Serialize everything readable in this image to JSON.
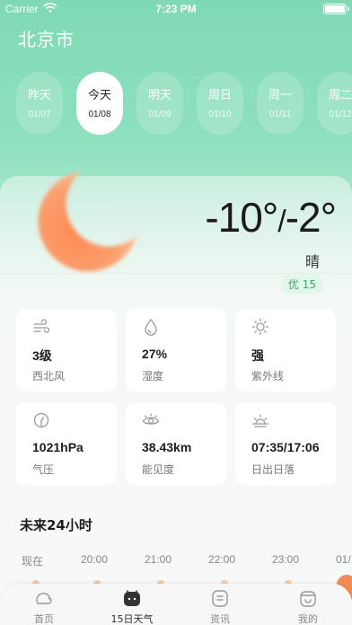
{
  "status_bar": {
    "carrier": "Carrier",
    "time": "7:23 PM"
  },
  "city": "北京市",
  "days": [
    {
      "name": "昨天",
      "date": "01/07",
      "active": false
    },
    {
      "name": "今天",
      "date": "01/08",
      "active": true
    },
    {
      "name": "明天",
      "date": "01/09",
      "active": false
    },
    {
      "name": "周日",
      "date": "01/10",
      "active": false
    },
    {
      "name": "周一",
      "date": "01/11",
      "active": false
    },
    {
      "name": "周二",
      "date": "01/12",
      "active": false
    }
  ],
  "weather": {
    "low": "-10°",
    "high": "-2°",
    "condition": "晴",
    "aqi": "优 15"
  },
  "details": [
    {
      "icon": "wind-icon",
      "value": "3级",
      "label": "西北风"
    },
    {
      "icon": "humidity-icon",
      "value": "27%",
      "label": "湿度"
    },
    {
      "icon": "sun-icon",
      "value": "强",
      "label": "紫外线"
    },
    {
      "icon": "pressure-icon",
      "value": "1021hPa",
      "label": "气压"
    },
    {
      "icon": "visibility-icon",
      "value": "38.43km",
      "label": "能见度"
    },
    {
      "icon": "sunrise-icon",
      "value": "07:35/17:06",
      "label": "日出日落"
    }
  ],
  "forecast_24h": {
    "title": "未来24小时",
    "hours": [
      "现在",
      "20:00",
      "21:00",
      "22:00",
      "23:00",
      "01/"
    ]
  },
  "tabs": [
    {
      "icon": "home-icon",
      "label": "首页",
      "active": false
    },
    {
      "icon": "calendar-icon",
      "label": "15日天气",
      "active": true
    },
    {
      "icon": "news-icon",
      "label": "资讯",
      "active": false
    },
    {
      "icon": "profile-icon",
      "label": "我的",
      "active": false
    }
  ],
  "colors": {
    "accent": "#7fd9b4",
    "moon": "#f7925f",
    "aqi_green": "#3aa96a"
  }
}
